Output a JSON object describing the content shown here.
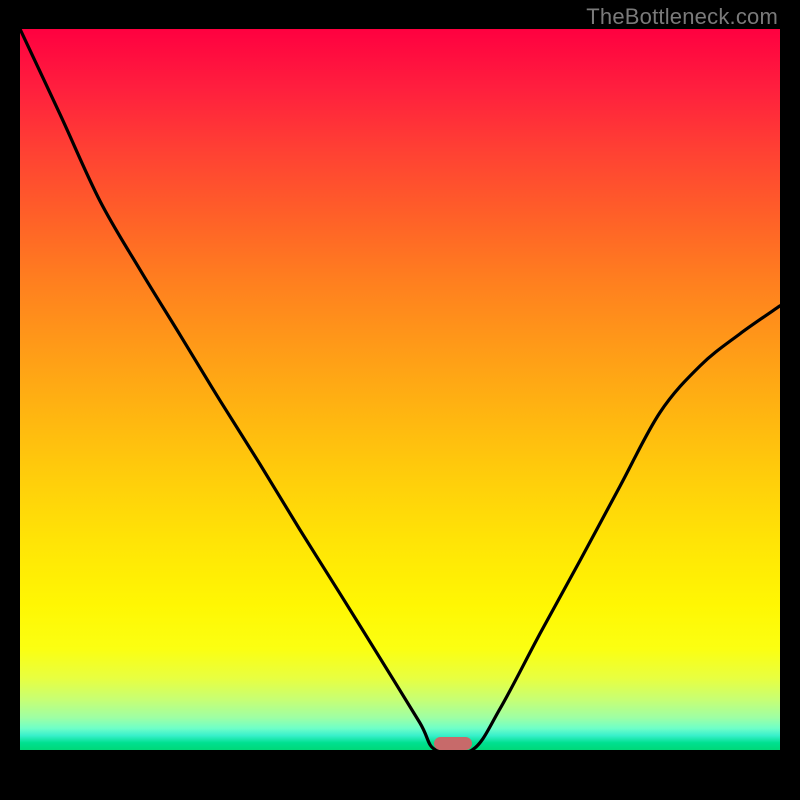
{
  "watermark": "TheBottleneck.com",
  "colors": {
    "marker": "#c76a6a",
    "curve": "#000000"
  },
  "marker": {
    "x_fraction": 0.57,
    "width_fraction": 0.05
  },
  "chart_data": {
    "type": "line",
    "title": "",
    "xlabel": "",
    "ylabel": "",
    "xlim": [
      0,
      1
    ],
    "ylim": [
      0,
      100
    ],
    "grid": false,
    "legend": false,
    "series": [
      {
        "name": "bottleneck-curve",
        "x": [
          0.0,
          0.053,
          0.105,
          0.158,
          0.211,
          0.263,
          0.316,
          0.368,
          0.421,
          0.474,
          0.526,
          0.547,
          0.595,
          0.632,
          0.684,
          0.737,
          0.789,
          0.842,
          0.895,
          0.947,
          1.0
        ],
        "y": [
          100.0,
          88.1,
          76.2,
          66.6,
          57.5,
          48.5,
          39.6,
          30.6,
          21.7,
          12.7,
          3.8,
          0.0,
          0.0,
          5.8,
          16.1,
          26.3,
          36.5,
          46.8,
          53.3,
          57.7,
          61.6
        ]
      }
    ],
    "annotations": [],
    "background_gradient": [
      "#ff0040",
      "#00d878"
    ]
  }
}
